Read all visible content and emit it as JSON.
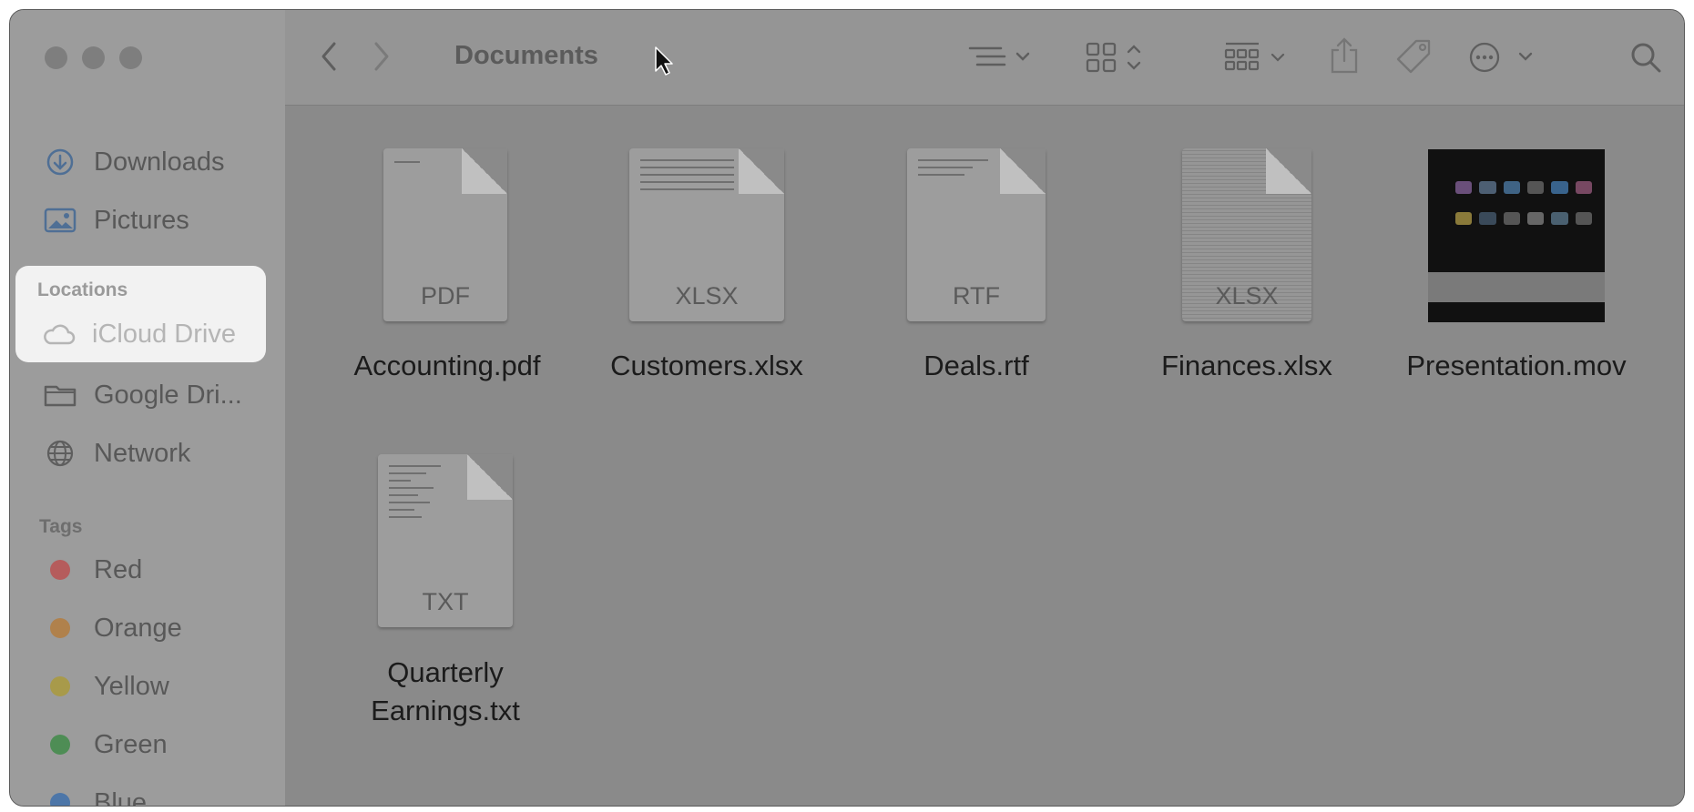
{
  "window": {
    "title": "Documents",
    "traffic_lights": [
      "close-button",
      "minimize-button",
      "zoom-button"
    ]
  },
  "sidebar": {
    "favorites": [
      {
        "label": "Downloads",
        "icon": "download-circle-icon"
      },
      {
        "label": "Pictures",
        "icon": "photo-icon"
      }
    ],
    "locations_label": "Locations",
    "locations": [
      {
        "label": "iCloud Drive",
        "icon": "cloud-icon",
        "highlighted": true
      },
      {
        "label": "Google Dri...",
        "icon": "folder-icon"
      },
      {
        "label": "Network",
        "icon": "globe-icon"
      }
    ],
    "tags_label": "Tags",
    "tags": [
      {
        "label": "Red",
        "color": "#b55c5c"
      },
      {
        "label": "Orange",
        "color": "#b0814c"
      },
      {
        "label": "Yellow",
        "color": "#a89a4a"
      },
      {
        "label": "Green",
        "color": "#4e8d55"
      },
      {
        "label": "Blue",
        "color": "#4d76a8"
      }
    ]
  },
  "toolbar": {
    "icons": [
      "back-chevron-icon",
      "forward-chevron-icon",
      "list-view-icon",
      "grid-view-icon",
      "group-icon",
      "share-icon",
      "tag-icon",
      "more-icon",
      "search-icon"
    ]
  },
  "files": [
    {
      "name": "Accounting.pdf",
      "ext": "PDF"
    },
    {
      "name": "Customers.xlsx",
      "ext": "XLSX"
    },
    {
      "name": "Deals.rtf",
      "ext": "RTF"
    },
    {
      "name": "Finances.xlsx",
      "ext": "XLSX"
    },
    {
      "name": "Presentation.mov",
      "ext": ""
    },
    {
      "name_line1": "Quarterly",
      "name_line2": "Earnings.txt",
      "ext": "TXT"
    }
  ]
}
